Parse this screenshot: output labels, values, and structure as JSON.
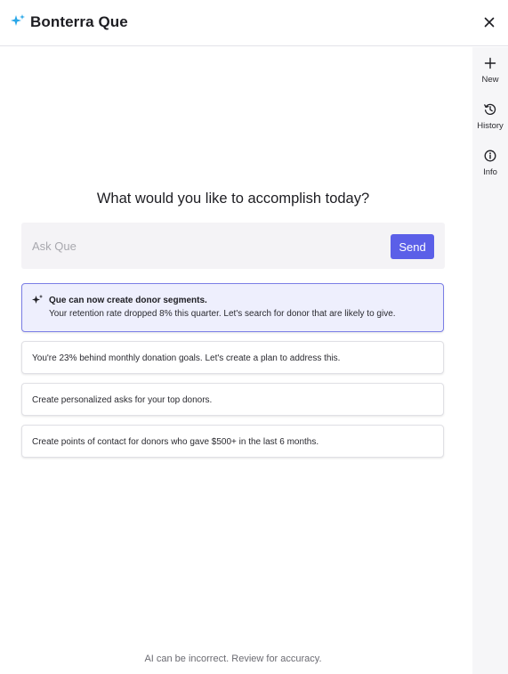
{
  "header": {
    "title": "Bonterra Que",
    "logo_icon": "sparkles-icon",
    "close_icon": "close-icon"
  },
  "rail": {
    "items": [
      {
        "label": "New",
        "icon": "plus-icon"
      },
      {
        "label": "History",
        "icon": "history-icon"
      },
      {
        "label": "Info",
        "icon": "info-icon"
      }
    ]
  },
  "main": {
    "heading": "What would you like to accomplish today?",
    "ask": {
      "placeholder": "Ask Que",
      "value": "",
      "send_label": "Send"
    },
    "suggestions": [
      {
        "title": "Que can now create donor segments.",
        "text": "Your retention rate dropped 8% this quarter. Let's search for donor that are likely to give."
      },
      {
        "text": "You're 23% behind monthly donation goals. Let's create a plan to address this."
      },
      {
        "text": "Create personalized asks for your top donors."
      },
      {
        "text": "Create points of contact for donors who gave $500+ in the last 6 months."
      }
    ],
    "footer_note": "AI can be incorrect. Review for accuracy."
  },
  "colors": {
    "accent": "#5b5fe8",
    "featured_bg": "#eeeffd",
    "featured_border": "#7b7ee6",
    "rail_bg": "#f6f6f8",
    "logo_blue": "#2aa7e8"
  }
}
